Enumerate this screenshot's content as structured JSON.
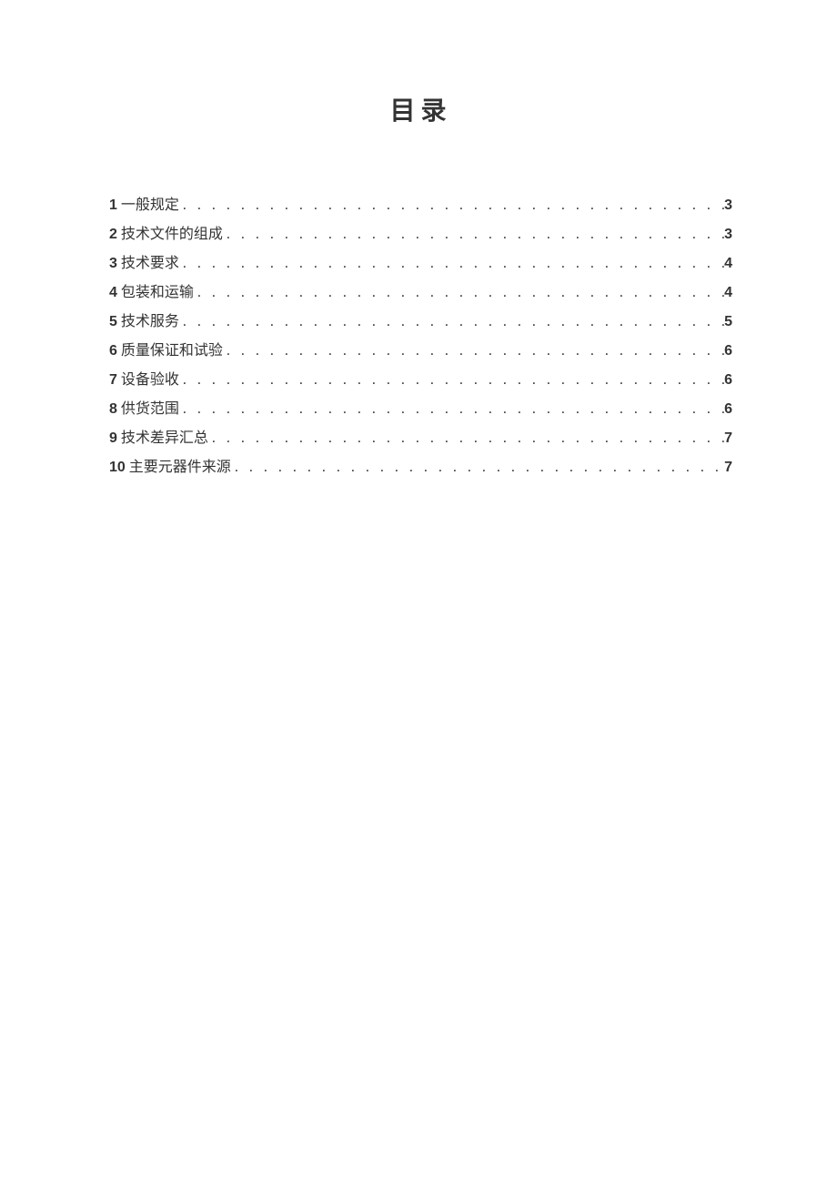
{
  "title": "目录",
  "toc": [
    {
      "num": "1",
      "label": "一般规定",
      "page": "3"
    },
    {
      "num": "2",
      "label": "技术文件的组成",
      "page": "3"
    },
    {
      "num": "3",
      "label": "技术要求",
      "page": "4"
    },
    {
      "num": "4",
      "label": "包装和运输",
      "page": "4"
    },
    {
      "num": "5",
      "label": "技术服务",
      "page": "5"
    },
    {
      "num": "6",
      "label": "质量保证和试验",
      "page": "6"
    },
    {
      "num": "7",
      "label": "设备验收",
      "page": "6"
    },
    {
      "num": "8",
      "label": "供货范围",
      "page": "6"
    },
    {
      "num": "9",
      "label": "技术差异汇总",
      "page": "7"
    },
    {
      "num": "10",
      "label": "主要元器件来源",
      "page": "7"
    }
  ]
}
